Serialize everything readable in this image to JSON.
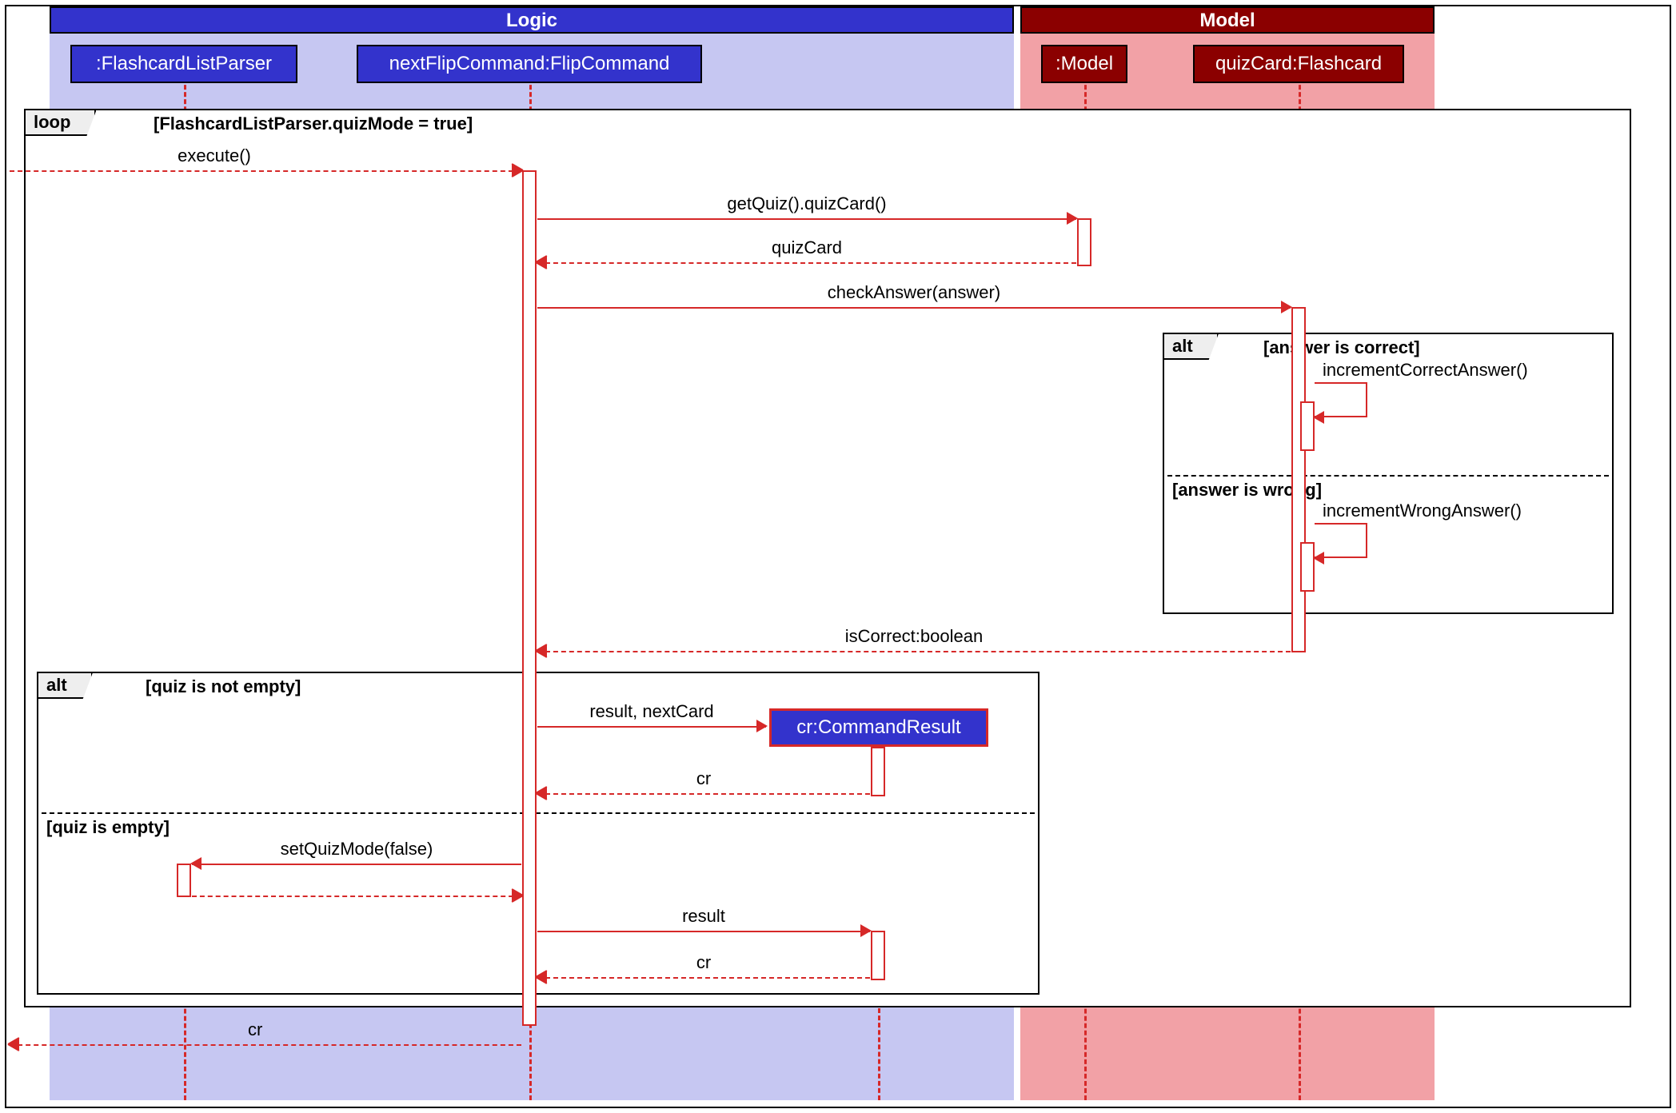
{
  "groups": {
    "logic": {
      "title": "Logic"
    },
    "model": {
      "title": "Model"
    }
  },
  "participants": {
    "flashcardParser": ":FlashcardListParser",
    "flipCommand": "nextFlipCommand:FlipCommand",
    "model": ":Model",
    "quizCard": "quizCard:Flashcard",
    "commandResult": "cr:CommandResult"
  },
  "fragments": {
    "loop": {
      "label": "loop",
      "guard": "[FlashcardListParser.quizMode = true]"
    },
    "altAnswer": {
      "label": "alt",
      "guard1": "[answer is correct]",
      "guard2": "[answer is wrong]"
    },
    "altQuiz": {
      "label": "alt",
      "guard1": "[quiz is not empty]",
      "guard2": "[quiz is empty]"
    }
  },
  "messages": {
    "execute": "execute()",
    "getQuiz": "getQuiz().quizCard()",
    "retQuizCard": "quizCard",
    "checkAnswer": "checkAnswer(answer)",
    "incCorrect": "incrementCorrectAnswer()",
    "incWrong": "incrementWrongAnswer()",
    "retIsCorrect": "isCorrect:boolean",
    "resultNextCard": "result, nextCard",
    "retCr1": "cr",
    "setQuizMode": "setQuizMode(false)",
    "result": "result",
    "retCr2": "cr",
    "retCrFinal": "cr"
  },
  "colors": {
    "logicAccent": "#3333cc",
    "modelAccent": "#8b0000",
    "logicFill": "#c6c7f2",
    "modelFill": "#f2a1a6",
    "seqLine": "#d62828"
  }
}
